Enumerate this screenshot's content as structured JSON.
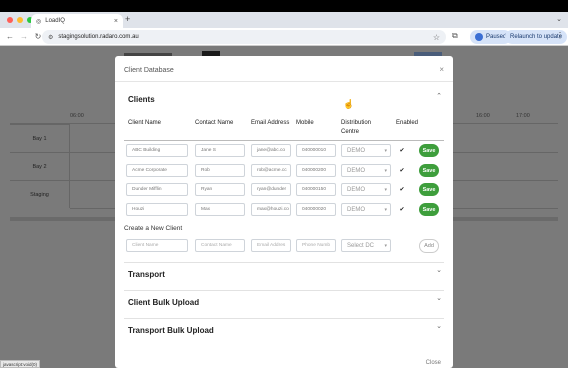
{
  "browser": {
    "tab_title": "LoadIQ",
    "url": "stagingsolution.radaro.com.au",
    "paused_label": "Paused",
    "relaunch_label": "Relaunch to update",
    "status_text": "javascript:void(0)"
  },
  "background": {
    "times": [
      "06:00",
      "16:00",
      "17:00"
    ],
    "bays": [
      "Bay 1",
      "Bay 2",
      "Staging"
    ]
  },
  "modal": {
    "title": "Client Database",
    "close_x": "×",
    "clients_title": "Clients",
    "columns": {
      "client_name": "Client Name",
      "contact_name": "Contact Name",
      "email": "Email Address",
      "mobile": "Mobile",
      "dc": "Distribution Centre",
      "enabled": "Enabled"
    },
    "rows": [
      {
        "client": "ABC Building",
        "contact": "Jane S",
        "email": "jane@abc.co",
        "mobile": "040000010",
        "dc": "DEMO",
        "enabled": true,
        "save": "Save"
      },
      {
        "client": "Acme Corporate",
        "contact": "Rob",
        "email": "rob@acme.cc",
        "mobile": "040000200",
        "dc": "DEMO",
        "enabled": true,
        "save": "Save"
      },
      {
        "client": "Dunder Mifflin",
        "contact": "Ryan",
        "email": "ryan@dunder",
        "mobile": "040000150",
        "dc": "DEMO",
        "enabled": true,
        "save": "Save"
      },
      {
        "client": "Houzi",
        "contact": "Max",
        "email": "max@houzi.co",
        "mobile": "040000020",
        "dc": "DEMO",
        "enabled": true,
        "save": "Save"
      }
    ],
    "new_client": {
      "title": "Create a New Client",
      "client_placeholder": "Client Name",
      "contact_placeholder": "Contact Name",
      "email_placeholder": "Email Addres",
      "phone_placeholder": "Phone Numb",
      "dc_placeholder": "Select DC",
      "add_label": "Add"
    },
    "sections": [
      "Transport",
      "Client Bulk Upload",
      "Transport Bulk Upload"
    ],
    "footer_close": "Close"
  },
  "colors": {
    "save_green": "#3e9e3c",
    "overlay": "#7a7a7a"
  }
}
